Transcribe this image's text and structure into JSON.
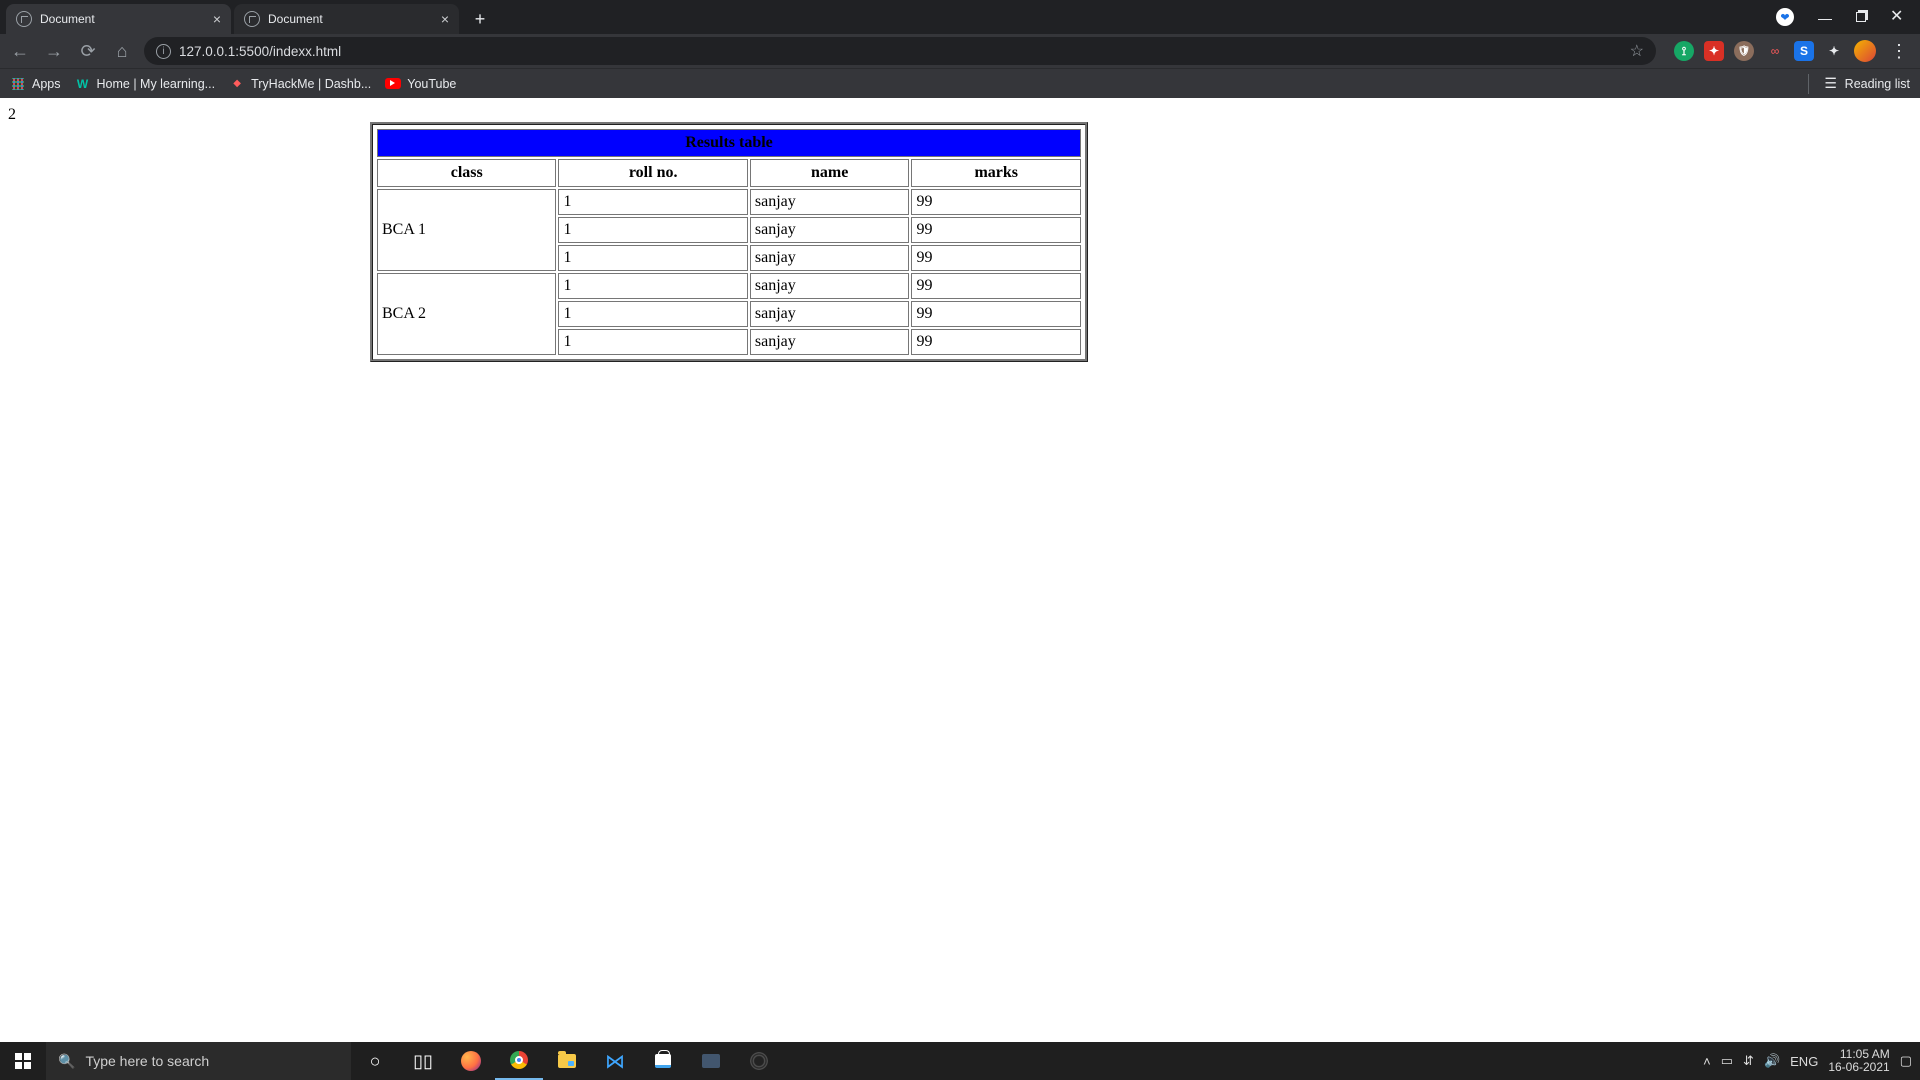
{
  "browser": {
    "tabs": [
      {
        "title": "Document",
        "active": true
      },
      {
        "title": "Document",
        "active": false
      }
    ],
    "url": "127.0.0.1:5500/indexx.html",
    "bookmarks": {
      "apps": "Apps",
      "wiley": "Home | My learning...",
      "thm": "TryHackMe | Dashb...",
      "youtube": "YouTube",
      "reading_list": "Reading list"
    }
  },
  "page": {
    "top_text": "2",
    "table_title": "Results table",
    "columns": {
      "class": "class",
      "roll": "roll no.",
      "name": "name",
      "marks": "marks"
    },
    "groups": [
      {
        "class_label": "BCA 1",
        "rows": [
          {
            "roll": "1",
            "name": "sanjay",
            "marks": "99"
          },
          {
            "roll": "1",
            "name": "sanjay",
            "marks": "99"
          },
          {
            "roll": "1",
            "name": "sanjay",
            "marks": "99"
          }
        ]
      },
      {
        "class_label": "BCA 2",
        "rows": [
          {
            "roll": "1",
            "name": "sanjay",
            "marks": "99"
          },
          {
            "roll": "1",
            "name": "sanjay",
            "marks": "99"
          },
          {
            "roll": "1",
            "name": "sanjay",
            "marks": "99"
          }
        ]
      }
    ]
  },
  "taskbar": {
    "search_placeholder": "Type here to search",
    "lang": "ENG",
    "time": "11:05 AM",
    "date": "16-06-2021"
  }
}
